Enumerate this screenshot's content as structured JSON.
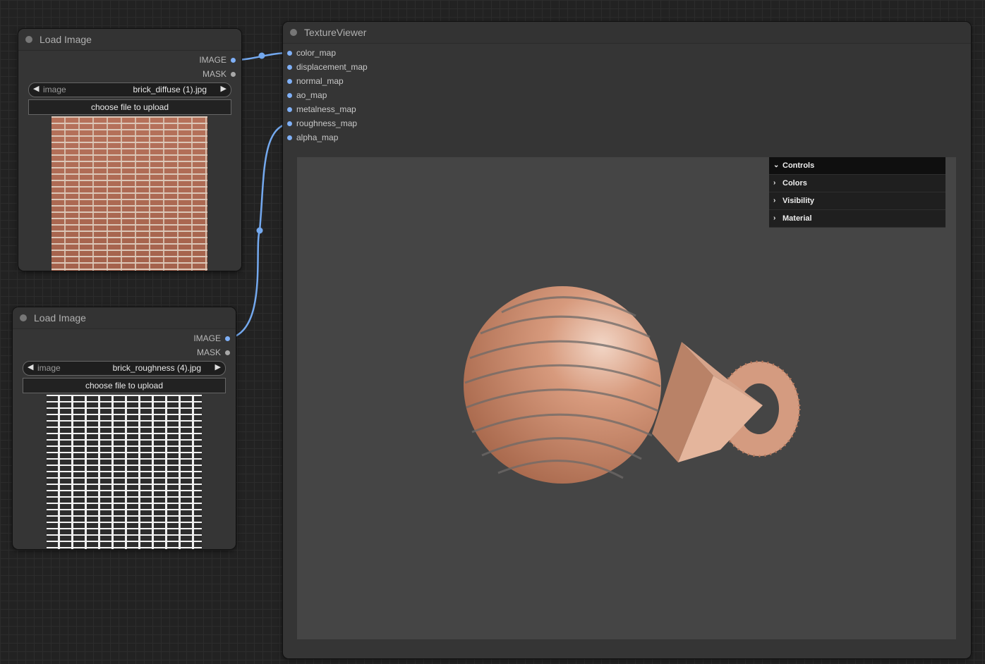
{
  "load_image_nodes": [
    {
      "title": "Load Image",
      "outputs": [
        {
          "label": "IMAGE",
          "color": "#7fb0f7"
        },
        {
          "label": "MASK",
          "color": "#a8a8a8"
        }
      ],
      "combo": {
        "label": "image",
        "value": "brick_diffuse (1).jpg"
      },
      "upload_label": "choose file to upload"
    },
    {
      "title": "Load Image",
      "outputs": [
        {
          "label": "IMAGE",
          "color": "#7fb0f7"
        },
        {
          "label": "MASK",
          "color": "#a8a8a8"
        }
      ],
      "combo": {
        "label": "image",
        "value": "brick_roughness (4).jpg"
      },
      "upload_label": "choose file to upload"
    }
  ],
  "texture_viewer": {
    "title": "TextureViewer",
    "inputs": [
      "color_map",
      "displacement_map",
      "normal_map",
      "ao_map",
      "metalness_map",
      "roughness_map",
      "alpha_map"
    ],
    "gui": {
      "controls": "Controls",
      "folders": [
        "Colors",
        "Visibility",
        "Material"
      ]
    }
  },
  "colors": {
    "link": "#74a9ef",
    "canvas_bg": "#454545",
    "brick": "#c98a6c"
  },
  "icons": {
    "combo_left": "triangle-left-icon",
    "combo_right": "triangle-right-icon",
    "folder_closed": "chevron-right-icon",
    "folder_open": "chevron-down-icon"
  }
}
